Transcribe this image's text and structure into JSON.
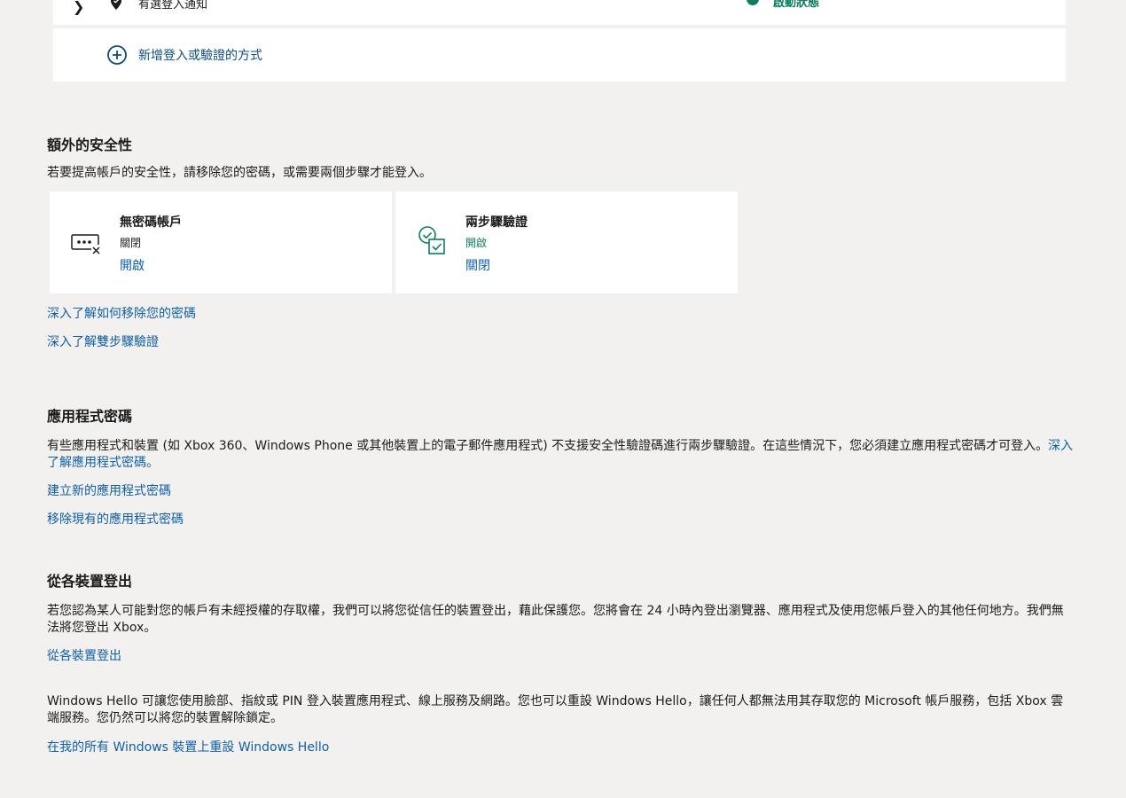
{
  "top_row": {
    "label": "有選登入通知",
    "status": "啟動狀態"
  },
  "add_method": {
    "label": "新增登入或驗證的方式"
  },
  "additional_security": {
    "heading": "額外的安全性",
    "description": "若要提高帳戶的安全性，請移除您的密碼，或需要兩個步驟才能登入。",
    "cards": [
      {
        "title": "無密碼帳戶",
        "state": "關閉",
        "action": "開啟"
      },
      {
        "title": "兩步驟驗證",
        "state": "開啟",
        "action": "關閉"
      }
    ],
    "links": [
      "深入了解如何移除您的密碼",
      "深入了解雙步驟驗證"
    ]
  },
  "app_passwords": {
    "heading": "應用程式密碼",
    "description": "有些應用程式和裝置 (如 Xbox 360、Windows Phone 或其他裝置上的電子郵件應用程式) 不支援安全性驗證碼進行兩步驟驗證。在這些情況下，您必須建立應用程式密碼才可登入。",
    "inline_link": "深入了解應用程式密碼。",
    "links": [
      "建立新的應用程式密碼",
      "移除現有的應用程式密碼"
    ]
  },
  "sign_out": {
    "heading": "從各裝置登出",
    "description": "若您認為某人可能對您的帳戶有未經授權的存取權，我們可以將您從信任的裝置登出，藉此保護您。您將會在 24 小時內登出瀏覽器、應用程式及使用您帳戶登入的其他任何地方。我們無法將您登出 Xbox。",
    "link": "從各裝置登出"
  },
  "windows_hello": {
    "description": "Windows Hello 可讓您使用臉部、指紋或 PIN 登入裝置應用程式、線上服務及網路。您也可以重設 Windows Hello，讓任何人都無法用其存取您的 Microsoft 帳戶服務，包括 Xbox 雲端服務。您仍然可以將您的裝置解除鎖定。",
    "link": "在我的所有 Windows 裝置上重設 Windows Hello"
  },
  "colors": {
    "background": "#f2f1f0",
    "card": "#ffffff",
    "link": "#0f5fa8",
    "success": "#0f7b5f"
  }
}
